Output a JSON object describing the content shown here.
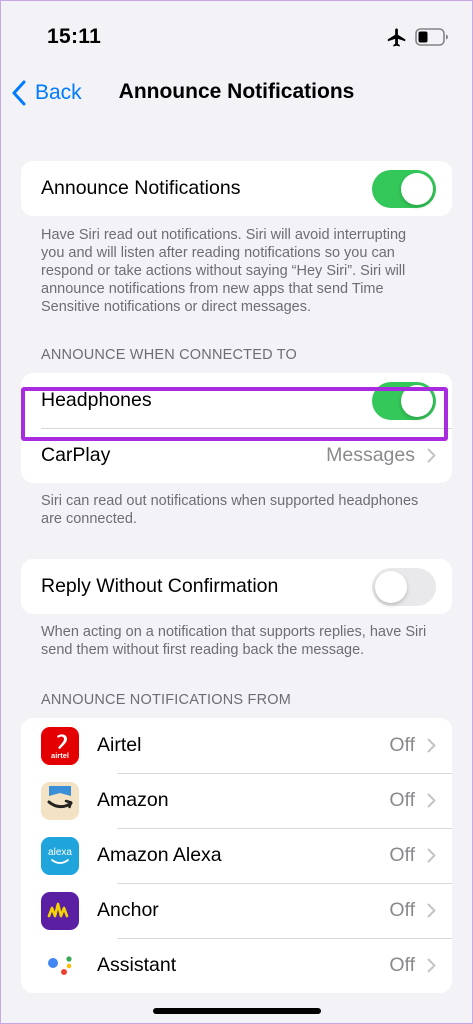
{
  "status_bar": {
    "time": "15:11"
  },
  "nav": {
    "back_label": "Back",
    "title": "Announce Notifications"
  },
  "announce": {
    "label": "Announce Notifications",
    "enabled": true,
    "footer": "Have Siri read out notifications. Siri will avoid interrupting you and will listen after reading notifications so you can respond or take actions without saying “Hey Siri”. Siri will announce notifications from new apps that send Time Sensitive notifications or direct messages."
  },
  "connected": {
    "header": "ANNOUNCE WHEN CONNECTED TO",
    "headphones_label": "Headphones",
    "headphones_enabled": true,
    "carplay_label": "CarPlay",
    "carplay_value": "Messages",
    "footer": "Siri can read out notifications when supported headphones are connected."
  },
  "reply": {
    "label": "Reply Without Confirmation",
    "enabled": false,
    "footer": "When acting on a notification that supports replies, have Siri send them without first reading back the message."
  },
  "apps": {
    "header": "ANNOUNCE NOTIFICATIONS FROM",
    "items": [
      {
        "name": "Airtel",
        "value": "Off",
        "icon": "airtel-icon"
      },
      {
        "name": "Amazon",
        "value": "Off",
        "icon": "amazon-icon"
      },
      {
        "name": "Amazon Alexa",
        "value": "Off",
        "icon": "alexa-icon"
      },
      {
        "name": "Anchor",
        "value": "Off",
        "icon": "anchor-icon"
      },
      {
        "name": "Assistant",
        "value": "Off",
        "icon": "google-assistant-icon"
      }
    ],
    "icon_texts": {
      "airtel": "airtel",
      "alexa": "alexa"
    }
  },
  "colors": {
    "accent": "#007aff",
    "toggle_on": "#34c759",
    "highlight": "#a82be0",
    "airtel": "#e40000",
    "amazon_bg": "#f3e2c3",
    "alexa": "#1fa5dc",
    "anchor": "#5a1fa3"
  }
}
